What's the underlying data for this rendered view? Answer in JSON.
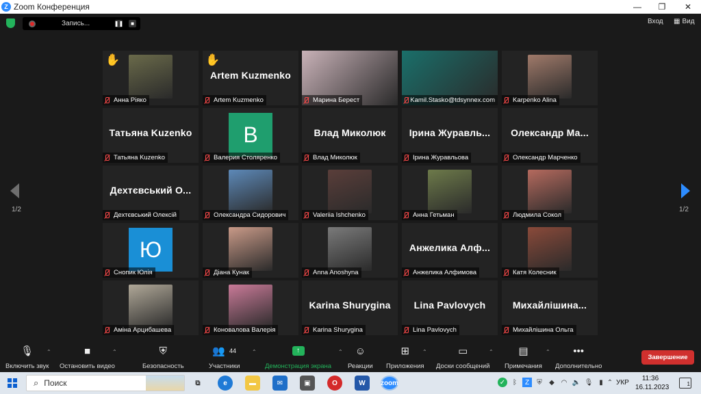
{
  "window": {
    "title": "Zoom Конференция",
    "minimize": "—",
    "restore": "❐",
    "close": "✕"
  },
  "topbar": {
    "recording_label": "Запись...",
    "pause": "❚❚",
    "stop": "■",
    "exit_label": "Вход",
    "view_label": "Вид"
  },
  "pagination": {
    "left_page": "1/2",
    "right_page": "1/2"
  },
  "participants": [
    {
      "name": "Анна Ріяко",
      "hand": true,
      "kind": "photo",
      "color": "#6a6a4a"
    },
    {
      "name": "Artem Kuzmenko",
      "hand": true,
      "kind": "bigname",
      "display": "Artem Kuzmenko"
    },
    {
      "name": "Марина Берест",
      "kind": "widephoto",
      "color": "#c9b2b8"
    },
    {
      "name": "Kamil.Stasko@tdsynnex.com",
      "kind": "widephoto",
      "color": "#1a6f6a",
      "speaking": true
    },
    {
      "name": "Karpenko Alina",
      "kind": "photo",
      "color": "#a07a6a"
    },
    {
      "name": "Татьяна Kuzenko",
      "kind": "bigname",
      "display": "Татьяна Kuzenko"
    },
    {
      "name": "Валерия Столяренко",
      "kind": "letter",
      "letter": "B",
      "color": "#1f9e6e"
    },
    {
      "name": "Влад Миколюк",
      "kind": "bigname",
      "display": "Влад Миколюк"
    },
    {
      "name": "Ірина Журавльова",
      "kind": "bigname",
      "display": "Ірина Журавль..."
    },
    {
      "name": "Олександр Марченко",
      "kind": "bigname",
      "display": "Олександр Ма..."
    },
    {
      "name": "Дехтєвський Олексій",
      "kind": "bigname",
      "display": "Дехтєвський О..."
    },
    {
      "name": "Олександра Сидорович",
      "kind": "photo",
      "color": "#5d89b8"
    },
    {
      "name": "Valeriia Ishchenko",
      "kind": "photo",
      "color": "#5a3e3a"
    },
    {
      "name": "Анна Гетьман",
      "kind": "photo",
      "color": "#6d7a4a"
    },
    {
      "name": "Людмила Сокол",
      "kind": "photo",
      "color": "#b56a5e"
    },
    {
      "name": "Снопик Юлія",
      "kind": "letter",
      "letter": "Ю",
      "color": "#1a8fd6"
    },
    {
      "name": "Діана Кунак",
      "kind": "photo",
      "color": "#c99a88"
    },
    {
      "name": "Anna Anoshyna",
      "kind": "photo",
      "color": "#7a7a7a"
    },
    {
      "name": "Анжелика Алфимова",
      "kind": "bigname",
      "display": "Анжелика Алф..."
    },
    {
      "name": "Катя Колесник",
      "kind": "photo",
      "color": "#8a4a3a"
    },
    {
      "name": "Аміна Арцибашева",
      "kind": "photo",
      "color": "#b0a898"
    },
    {
      "name": "Коновалова Валерія",
      "kind": "photo",
      "color": "#c97a98"
    },
    {
      "name": "Karina Shurygina",
      "kind": "bigname",
      "display": "Karina Shurygina"
    },
    {
      "name": "Lina Pavlovych",
      "kind": "bigname",
      "display": "Lina Pavlovych"
    },
    {
      "name": "Михайлішина Ольга",
      "kind": "bigname",
      "display": "Михайлішина..."
    }
  ],
  "toolbar": {
    "unmute": "Включить звук",
    "stop_video": "Остановить видео",
    "security": "Безопасность",
    "participants": "Участники",
    "participants_count": "44",
    "share": "Демонстрация экрана",
    "reactions": "Реакции",
    "apps": "Приложения",
    "whiteboards": "Доски сообщений",
    "notes": "Примечания",
    "more": "Дополнительно",
    "end": "Завершение",
    "share_color": "#23b35b"
  },
  "taskbar": {
    "search_label": "Поиск",
    "lang": "УКР",
    "time": "11:36",
    "date": "16.11.2023",
    "notifications": "1"
  }
}
